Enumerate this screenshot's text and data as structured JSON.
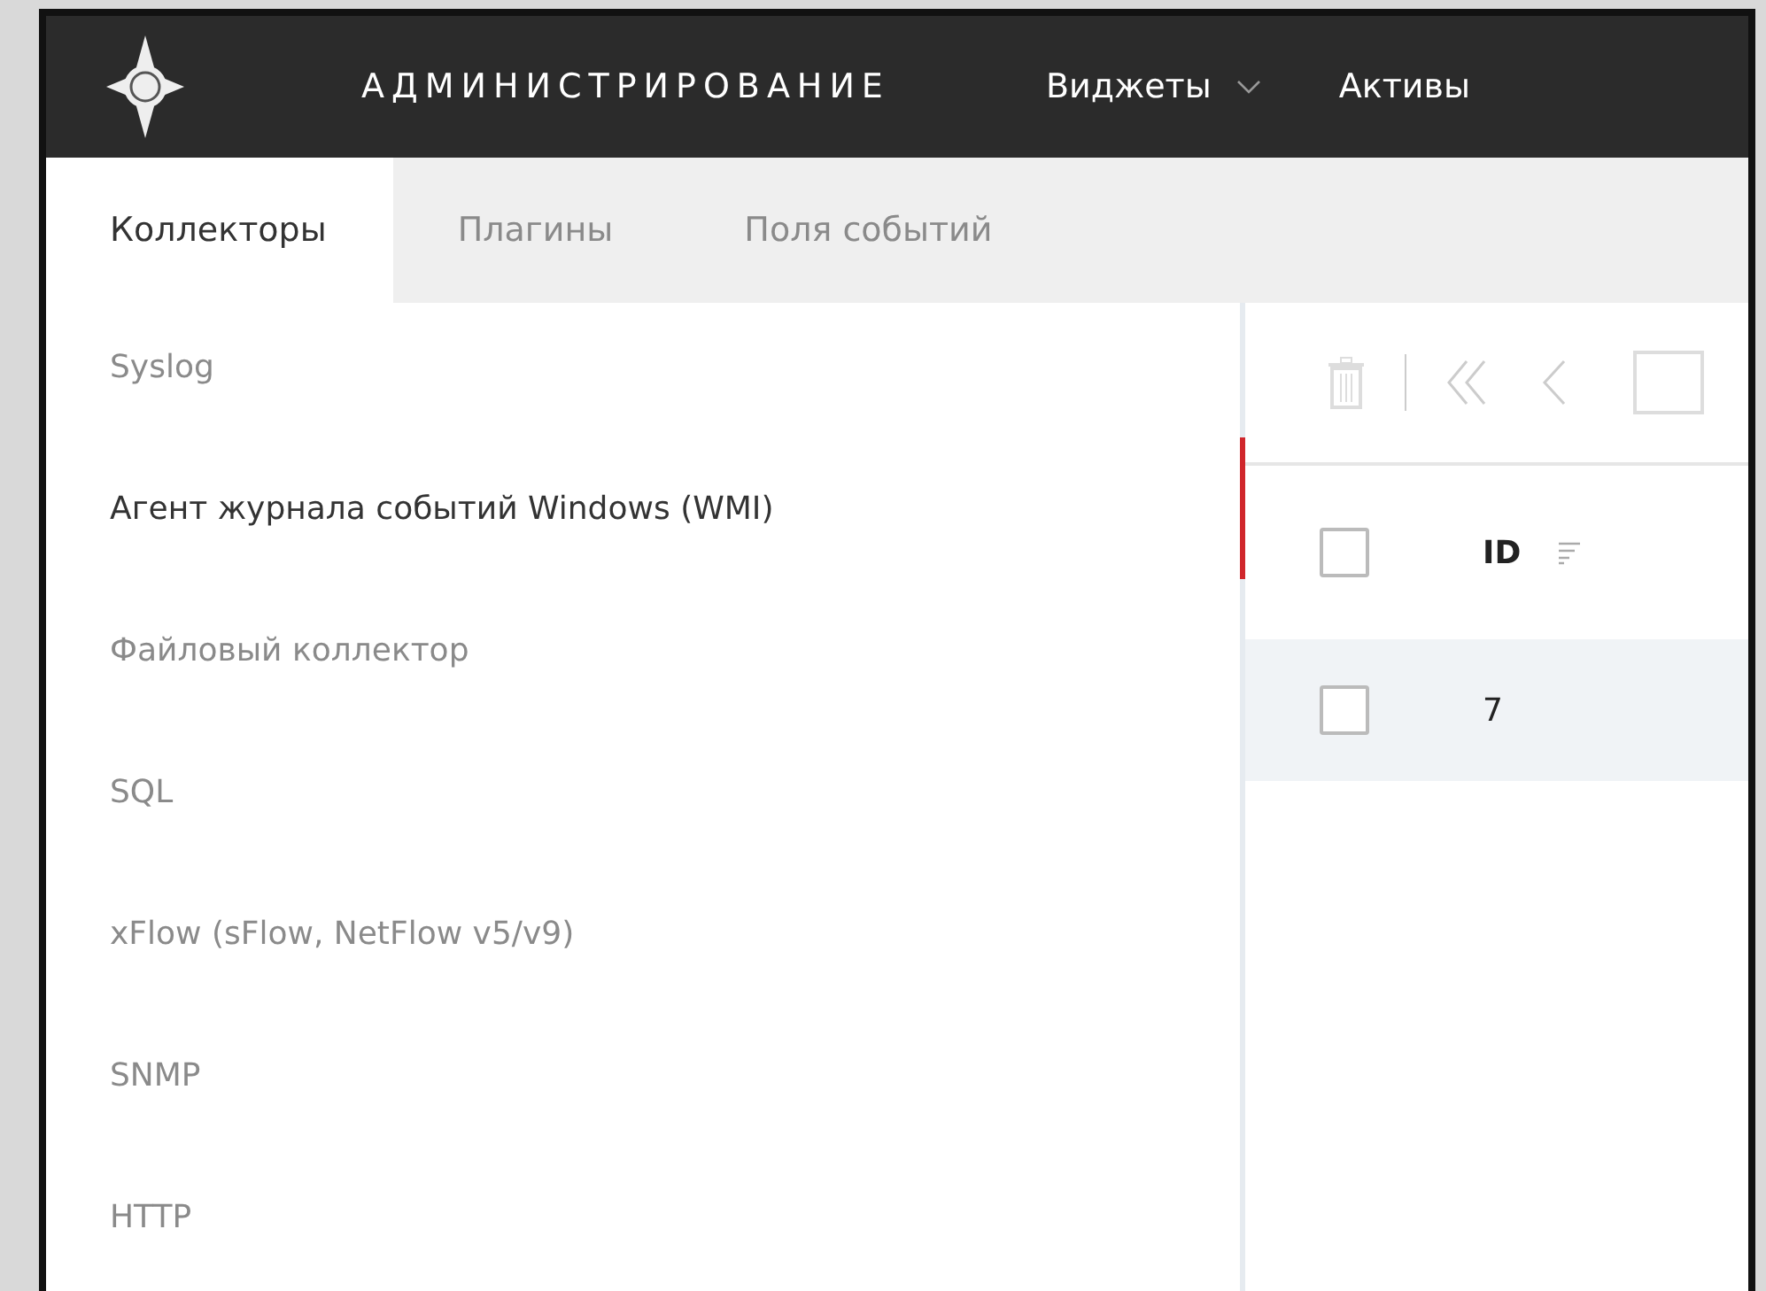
{
  "header": {
    "title": "АДМИНИСТРИРОВАНИЕ",
    "menu": [
      {
        "label": "Виджеты",
        "dropdown": true
      },
      {
        "label": "Активы",
        "dropdown": false
      }
    ]
  },
  "tabs": [
    {
      "label": "Коллекторы",
      "selected": true
    },
    {
      "label": "Плагины",
      "selected": false
    },
    {
      "label": "Поля событий",
      "selected": false
    }
  ],
  "collectors": [
    {
      "label": "Syslog",
      "selected": false
    },
    {
      "label": "Агент журнала событий Windows (WMI)",
      "selected": true
    },
    {
      "label": "Файловый коллектор",
      "selected": false
    },
    {
      "label": "SQL",
      "selected": false
    },
    {
      "label": "xFlow (sFlow, NetFlow v5/v9)",
      "selected": false
    },
    {
      "label": "SNMP",
      "selected": false
    },
    {
      "label": "HTTP",
      "selected": false
    }
  ],
  "table": {
    "columns": [
      {
        "label": "ID",
        "checked": false
      }
    ],
    "rows": [
      {
        "cells": [
          "7"
        ],
        "checked": false
      }
    ]
  }
}
